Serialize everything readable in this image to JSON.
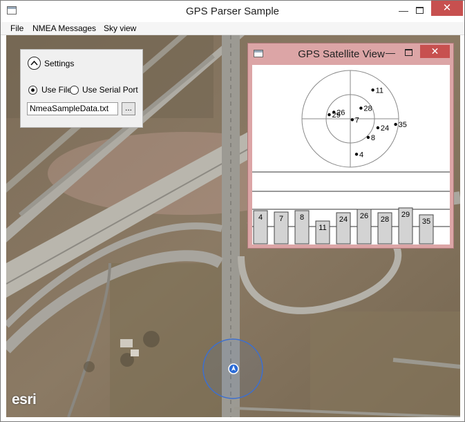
{
  "window": {
    "title": "GPS Parser Sample",
    "minimize_glyph": "—",
    "close_glyph": "✕"
  },
  "menu": [
    "File",
    "NMEA Messages",
    "Sky view"
  ],
  "map": {
    "attribution": "esri"
  },
  "settings": {
    "title": "Settings",
    "options": [
      {
        "label": "Use File",
        "checked": true
      },
      {
        "label": "Use Serial Port",
        "checked": false
      }
    ],
    "file_value": "NmeaSampleData.txt",
    "browse_label": "..."
  },
  "sky_window": {
    "title": "GPS Satellite View",
    "minimize_glyph": "—",
    "close_glyph": "✕"
  },
  "chart_data": {
    "type": "scatter",
    "description_type": "sky plot",
    "satellites": [
      {
        "id": "11",
        "azimuth": 38,
        "elevation": 22
      },
      {
        "id": "28",
        "azimuth": 45,
        "elevation": 62
      },
      {
        "id": "7",
        "azimuth": 115,
        "elevation": 86
      },
      {
        "id": "26",
        "azimuth": 292,
        "elevation": 57
      },
      {
        "id": "29",
        "azimuth": 281,
        "elevation": 50
      },
      {
        "id": "35",
        "azimuth": 97,
        "elevation": 5
      },
      {
        "id": "24",
        "azimuth": 108,
        "elevation": 36
      },
      {
        "id": "8",
        "azimuth": 136,
        "elevation": 42
      },
      {
        "id": "4",
        "azimuth": 170,
        "elevation": 23
      }
    ],
    "signal_bars": [
      {
        "id": "4",
        "value": 48
      },
      {
        "id": "7",
        "value": 46
      },
      {
        "id": "8",
        "value": 48
      },
      {
        "id": "11",
        "value": 33
      },
      {
        "id": "24",
        "value": 45
      },
      {
        "id": "26",
        "value": 50
      },
      {
        "id": "28",
        "value": 45
      },
      {
        "id": "29",
        "value": 52
      },
      {
        "id": "35",
        "value": 42
      }
    ]
  }
}
